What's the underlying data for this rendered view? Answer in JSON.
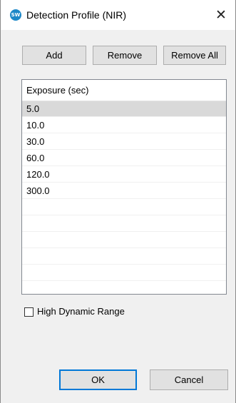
{
  "window": {
    "title": "Detection Profile (NIR)",
    "app_icon_text": "SW",
    "close_glyph": "✕"
  },
  "toolbar": {
    "add_label": "Add",
    "remove_label": "Remove",
    "remove_all_label": "Remove All"
  },
  "exposure_list": {
    "header": "Exposure (sec)",
    "selected_index": 0,
    "rows": [
      "5.0",
      "10.0",
      "30.0",
      "60.0",
      "120.0",
      "300.0",
      "",
      "",
      "",
      "",
      ""
    ]
  },
  "options": {
    "hdr_label": "High Dynamic Range",
    "hdr_checked": false
  },
  "footer": {
    "ok_label": "OK",
    "cancel_label": "Cancel"
  },
  "colors": {
    "accent": "#0078d7",
    "app_icon": "#1e88c8",
    "selected_row": "#d9d9d9"
  }
}
